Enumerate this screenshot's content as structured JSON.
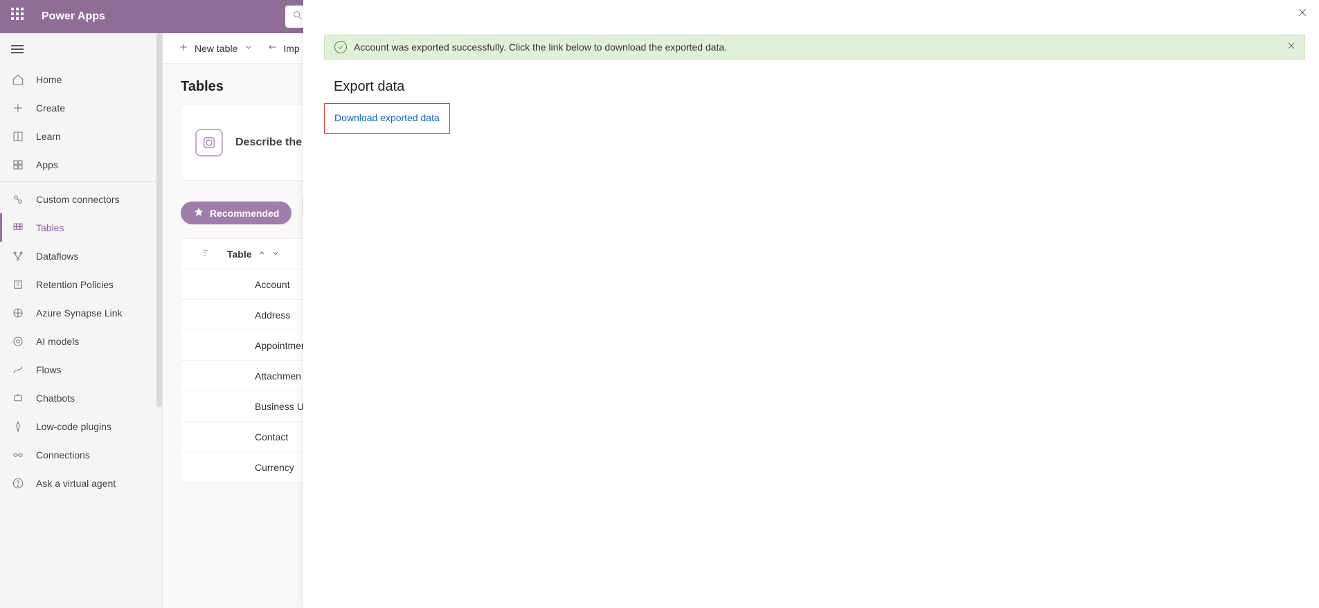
{
  "header": {
    "app_title": "Power Apps"
  },
  "sidebar": {
    "items": [
      {
        "label": "Home"
      },
      {
        "label": "Create"
      },
      {
        "label": "Learn"
      },
      {
        "label": "Apps"
      },
      {
        "label": "Custom connectors"
      },
      {
        "label": "Tables"
      },
      {
        "label": "Dataflows"
      },
      {
        "label": "Retention Policies"
      },
      {
        "label": "Azure Synapse Link"
      },
      {
        "label": "AI models"
      },
      {
        "label": "Flows"
      },
      {
        "label": "Chatbots"
      },
      {
        "label": "Low-code plugins"
      },
      {
        "label": "Connections"
      },
      {
        "label": "Ask a virtual agent"
      }
    ]
  },
  "commands": {
    "new_table": "New table",
    "import": "Imp"
  },
  "page": {
    "title": "Tables",
    "card_text": "Describe the",
    "recommended": "Recommended"
  },
  "table": {
    "header": "Table",
    "rows": [
      "Account",
      "Address",
      "Appointmen",
      "Attachmen",
      "Business U",
      "Contact",
      "Currency"
    ]
  },
  "panel": {
    "notice": "Account was exported successfully. Click the link below to download the exported data.",
    "title": "Export data",
    "download_link": "Download exported data"
  }
}
